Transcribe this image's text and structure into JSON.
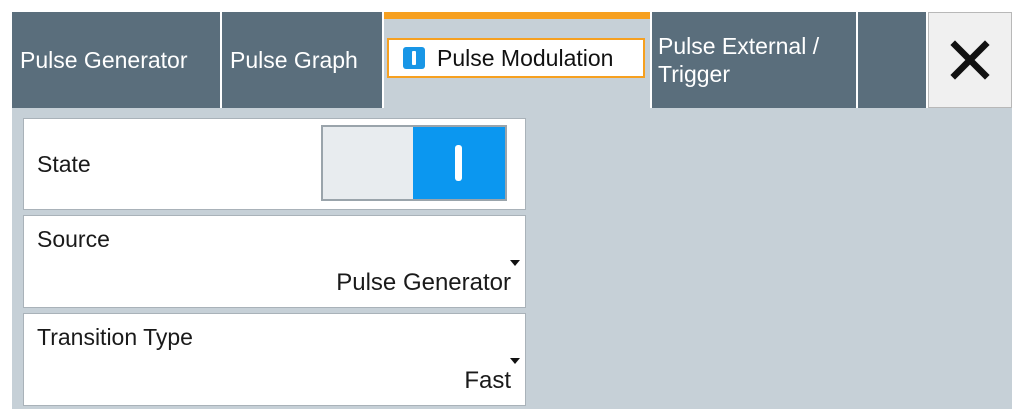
{
  "tabs": {
    "pulse_generator": "Pulse Generator",
    "pulse_graph": "Pulse Graph",
    "pulse_modulation": "Pulse Modulation",
    "pulse_external_line1": "Pulse External /",
    "pulse_external_line2": "Trigger"
  },
  "active_tab": "Pulse Modulation",
  "fields": {
    "state_label": "State",
    "state_value": "on",
    "source_label": "Source",
    "source_value": "Pulse Generator",
    "transition_label": "Transition Type",
    "transition_value": "Fast"
  },
  "icons": {
    "close": "close-icon",
    "dropdown": "dropdown-caret-icon",
    "active_indicator": "active-indicator-icon"
  },
  "colors": {
    "tab_inactive": "#5a6e7c",
    "tab_active_accent": "#f6a020",
    "panel_background": "#c6d0d7",
    "toggle_on": "#0b97f0"
  }
}
